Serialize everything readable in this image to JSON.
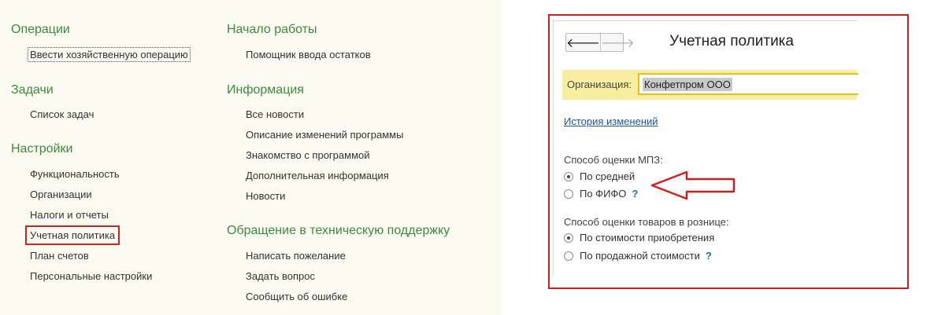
{
  "left_menu": {
    "col1": [
      {
        "title": "Операции",
        "items": [
          "Ввести хозяйственную операцию"
        ]
      },
      {
        "title": "Задачи",
        "items": [
          "Список задач"
        ]
      },
      {
        "title": "Настройки",
        "items": [
          "Функциональность",
          "Организации",
          "Налоги и отчеты",
          "Учетная политика",
          "План счетов",
          "Персональные настройки"
        ]
      }
    ],
    "col2": [
      {
        "title": "Начало работы",
        "items": [
          "Помощник ввода остатков"
        ]
      },
      {
        "title": "Информация",
        "items": [
          "Все новости",
          "Описание изменений программы",
          "Знакомство с программой",
          "Дополнительная информация",
          "Новости"
        ]
      },
      {
        "title": "Обращение в техническую поддержку",
        "items": [
          "Написать пожелание",
          "Задать вопрос",
          "Сообщить об ошибке"
        ]
      }
    ]
  },
  "form": {
    "nav_back": "🡐",
    "nav_forward": "🡒",
    "title": "Учетная политика",
    "org_label": "Организация:",
    "org_value": "Конфетпром ООО",
    "history_link": "История изменений",
    "mpz_label": "Способ оценки МПЗ:",
    "mpz_options": [
      {
        "label": "По средней",
        "selected": true,
        "help": ""
      },
      {
        "label": "По ФИФО",
        "selected": false,
        "help": "?"
      }
    ],
    "retail_label": "Способ оценки товаров в рознице:",
    "retail_options": [
      {
        "label": "По стоимости приобретения",
        "selected": true,
        "help": ""
      },
      {
        "label": "По продажной стоимости",
        "selected": false,
        "help": "?"
      }
    ]
  },
  "colors": {
    "section_title": "#3d8b3d",
    "highlight_red": "#cc2020",
    "org_bar": "#f9eea0",
    "link_blue": "#1a56a6"
  }
}
